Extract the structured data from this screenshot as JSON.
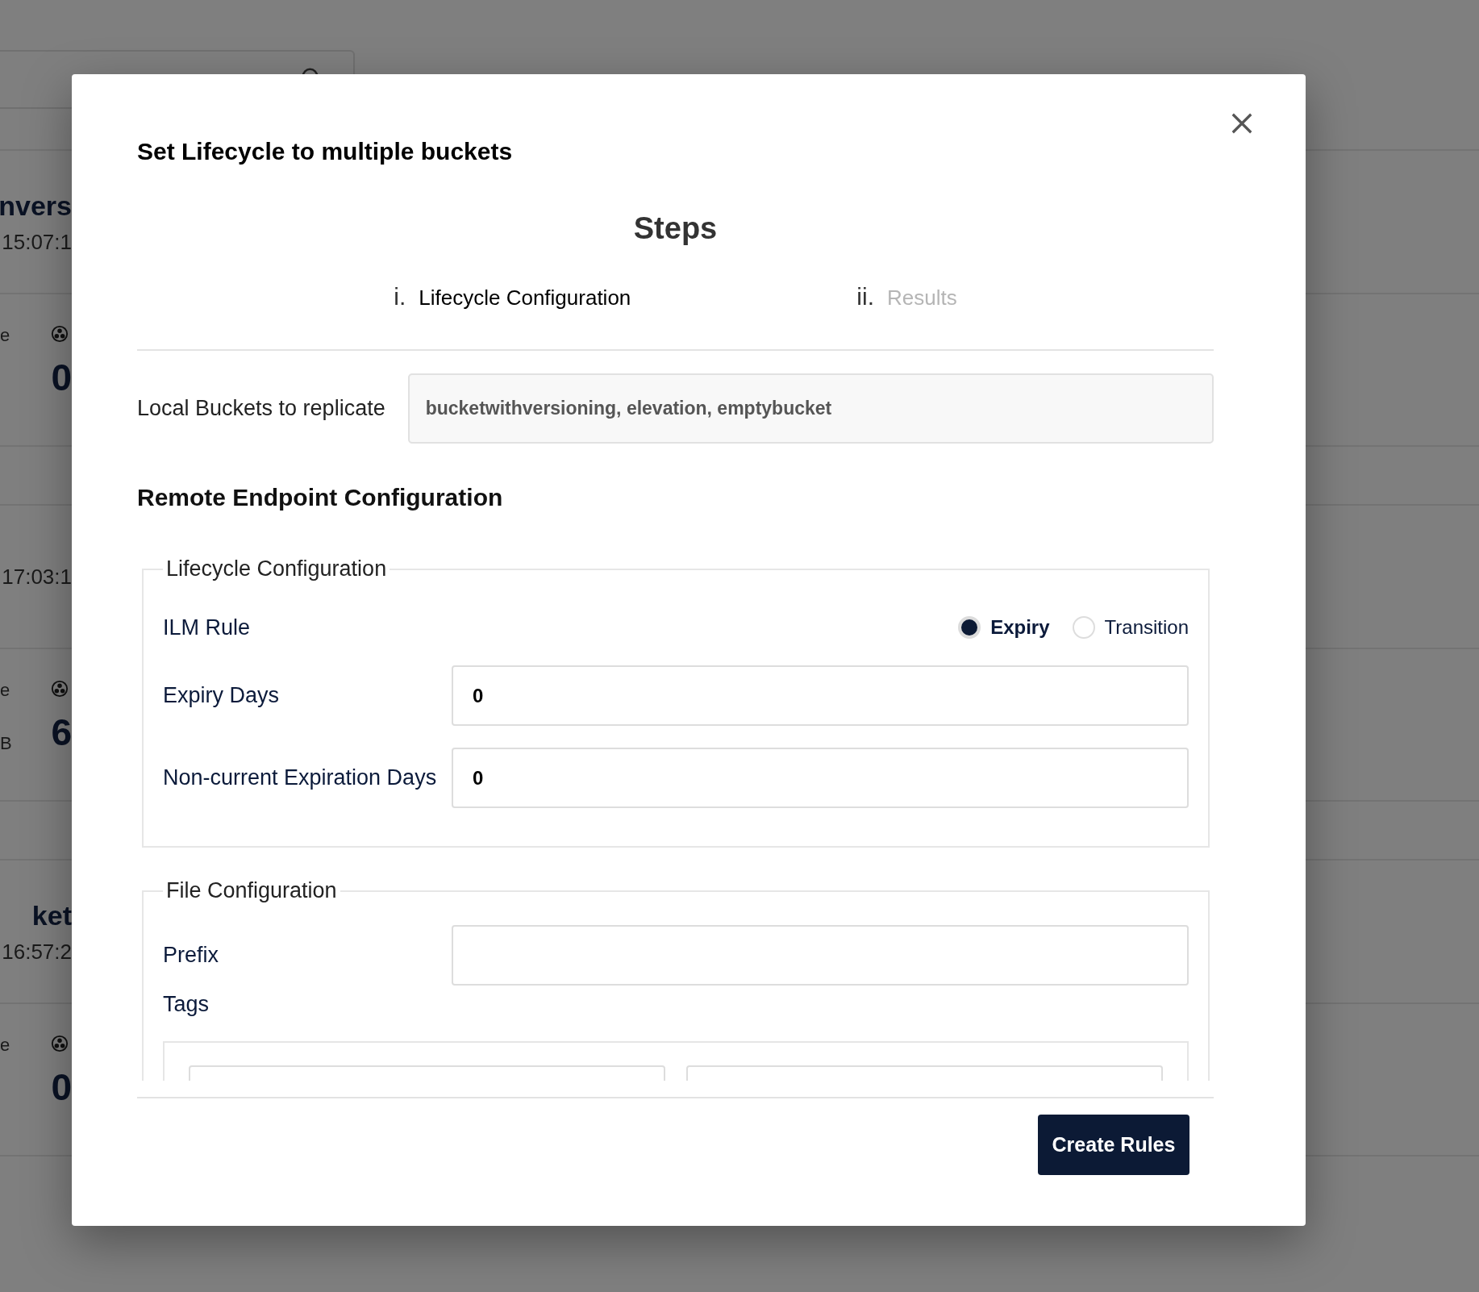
{
  "background": {
    "cards": [
      {
        "title": "nvers",
        "date": "15:07:1",
        "stats": {
          "label": "e",
          "value": "0"
        }
      },
      {
        "date": "17:03:1",
        "stats": {
          "label": "e",
          "unit": "B",
          "value": "6"
        }
      },
      {
        "title": "ket",
        "date": "16:57:2",
        "stats": {
          "label": "e",
          "value": "0"
        }
      }
    ]
  },
  "dialog": {
    "title": "Set Lifecycle to multiple buckets",
    "steps": {
      "title": "Steps",
      "items": [
        {
          "number": "i.",
          "label": "Lifecycle Configuration",
          "selected": true
        },
        {
          "number": "ii.",
          "label": "Results",
          "selected": false
        }
      ]
    },
    "local_buckets": {
      "label": "Local Buckets to replicate",
      "value": "bucketwithversioning, elevation, emptybucket"
    },
    "remote_heading": "Remote Endpoint Configuration",
    "lifecycle": {
      "legend": "Lifecycle Configuration",
      "ilm_rule": {
        "label": "ILM Rule",
        "options": [
          {
            "label": "Expiry",
            "selected": true
          },
          {
            "label": "Transition",
            "selected": false
          }
        ]
      },
      "expiry_days": {
        "label": "Expiry Days",
        "value": "0"
      },
      "noncurrent_days": {
        "label": "Non-current Expiration Days",
        "value": "0"
      }
    },
    "file_config": {
      "legend": "File Configuration",
      "prefix": {
        "label": "Prefix"
      },
      "tags": {
        "label": "Tags"
      }
    },
    "button": "Create Rules"
  }
}
